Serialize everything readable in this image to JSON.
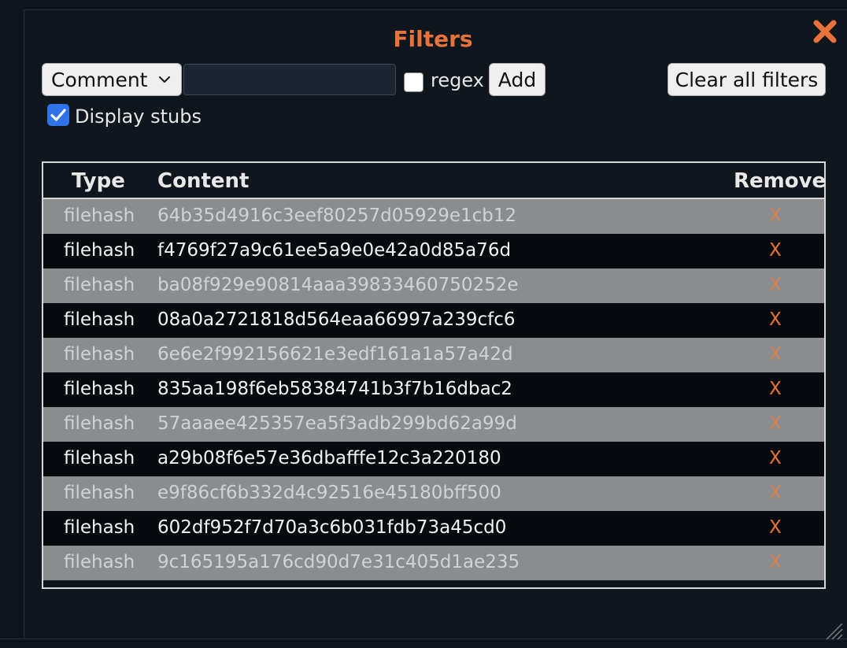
{
  "dialog": {
    "title": "Filters",
    "close_icon": "close-icon"
  },
  "controls": {
    "type_select_value": "Comment",
    "text_input_value": "",
    "regex_label": "regex",
    "regex_checked": false,
    "add_label": "Add",
    "clear_label": "Clear all filters",
    "display_stubs_label": "Display stubs",
    "display_stubs_checked": true
  },
  "table": {
    "headers": {
      "type": "Type",
      "content": "Content",
      "remove": "Remove"
    },
    "rows": [
      {
        "type": "filehash",
        "content": "64b35d4916c3eef80257d05929e1cb12",
        "remove": "X"
      },
      {
        "type": "filehash",
        "content": "f4769f27a9c61ee5a9e0e42a0d85a76d",
        "remove": "X"
      },
      {
        "type": "filehash",
        "content": "ba08f929e90814aaa39833460750252e",
        "remove": "X"
      },
      {
        "type": "filehash",
        "content": "08a0a2721818d564eaa66997a239cfc6",
        "remove": "X"
      },
      {
        "type": "filehash",
        "content": "6e6e2f992156621e3edf161a1a57a42d",
        "remove": "X"
      },
      {
        "type": "filehash",
        "content": "835aa198f6eb58384741b3f7b16dbac2",
        "remove": "X"
      },
      {
        "type": "filehash",
        "content": "57aaaee425357ea5f3adb299bd62a99d",
        "remove": "X"
      },
      {
        "type": "filehash",
        "content": "a29b08f6e57e36dbafffe12c3a220180",
        "remove": "X"
      },
      {
        "type": "filehash",
        "content": "e9f86cf6b332d4c92516e45180bff500",
        "remove": "X"
      },
      {
        "type": "filehash",
        "content": "602df952f7d70a3c6b031fdb73a45cd0",
        "remove": "X"
      },
      {
        "type": "filehash",
        "content": "9c165195a176cd90d7e31c405d1ae235",
        "remove": "X"
      }
    ]
  },
  "colors": {
    "accent": "#e8733a",
    "checkbox_blue": "#2f73e8",
    "row_light": "#8a8c8f",
    "row_dark": "#070b10"
  }
}
